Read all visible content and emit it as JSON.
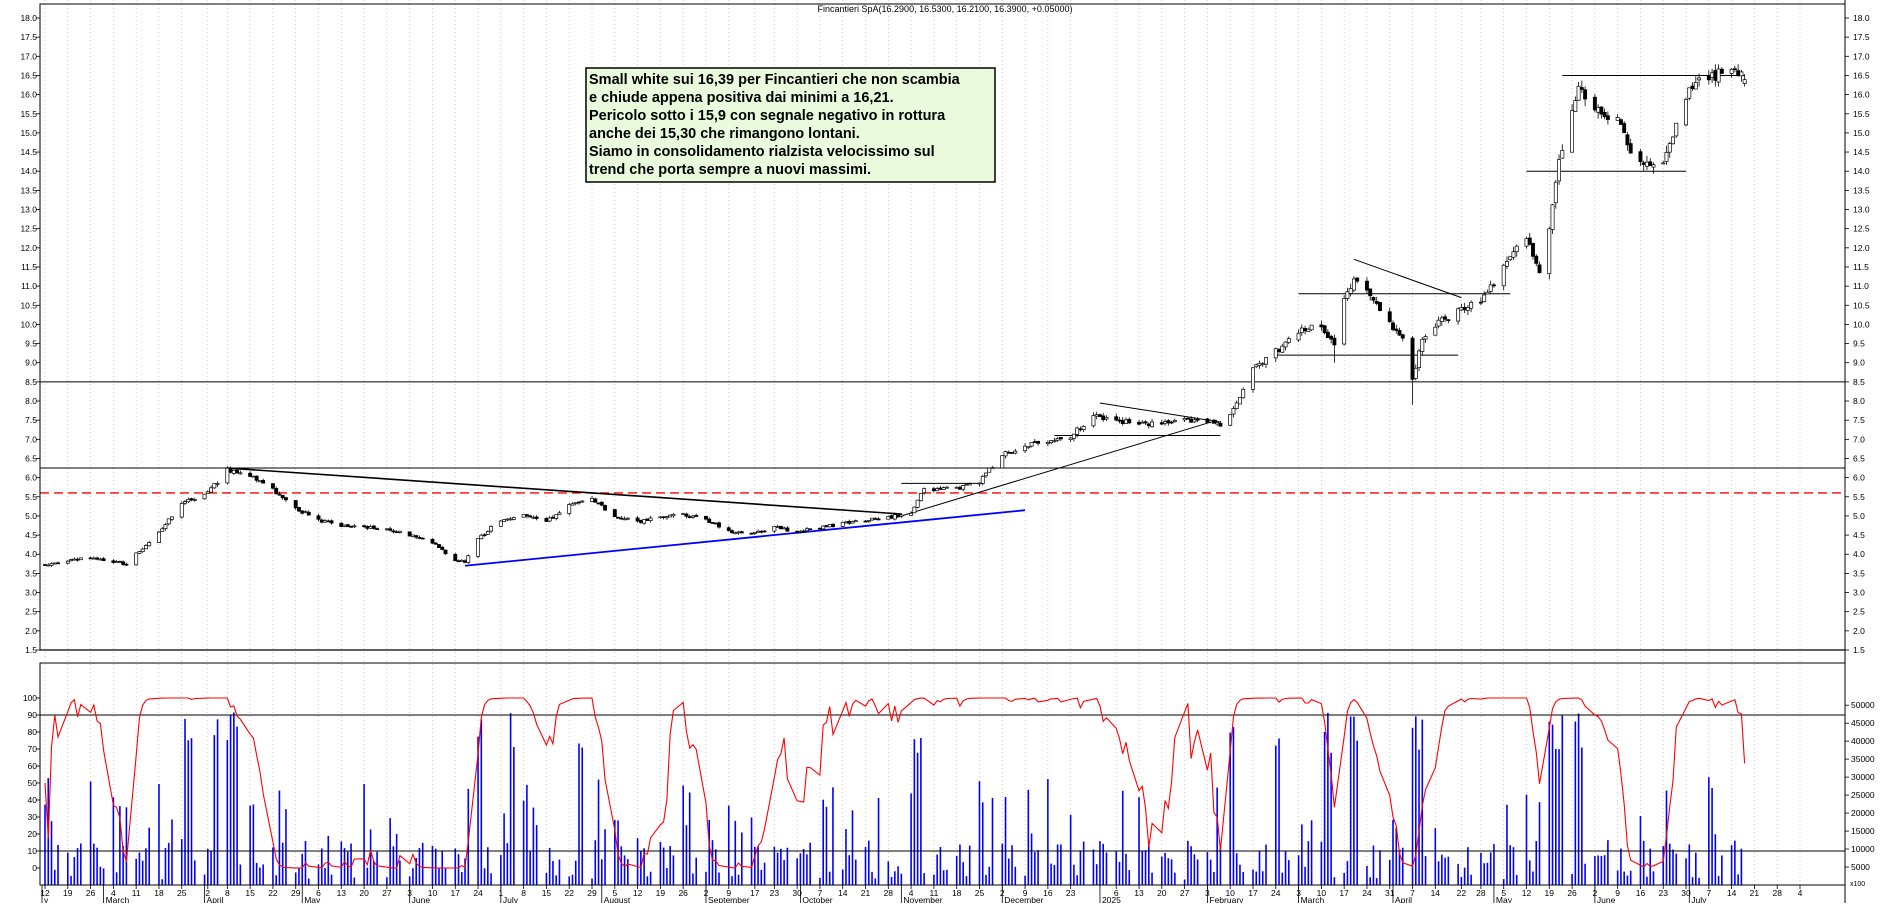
{
  "title": "Fincantieri SpA(16.2900, 16.5300, 16.2100, 16.3900, +0.05000)",
  "annotation": {
    "lines": [
      "Small white sui 16,39 per Fincantieri che non scambia",
      "e chiude appena positiva dai minimi a 16,21.",
      "Pericolo sotto i 15,9 con segnale negativo in rottura",
      "anche dei 15,30 che rimangono lontani.",
      "Siamo in consolidamento rialzista velocissimo sul",
      "trend che porta sempre a nuovi massimi."
    ],
    "bg_color": "#e9fbdc"
  },
  "colors": {
    "up": "#ffffff",
    "down": "#000000",
    "oscillator": "#ff0000",
    "volume": "#0000ff",
    "support_trendline": "#0000ff",
    "dashed_level": "#ff0000",
    "grid": "#b0b0b0"
  },
  "chart_data": [
    {
      "type": "candlestick",
      "name": "price",
      "grid": true,
      "ylim": [
        1.5,
        18.0
      ],
      "yticks": [
        "1.5",
        "2.0",
        "2.5",
        "3.0",
        "3.5",
        "4.0",
        "4.5",
        "5.0",
        "5.5",
        "6.0",
        "6.5",
        "7.0",
        "7.5",
        "8.0",
        "8.5",
        "9.0",
        "9.5",
        "10.0",
        "10.5",
        "11.0",
        "11.5",
        "12.0",
        "12.5",
        "13.0",
        "13.5",
        "14.0",
        "14.5",
        "15.0",
        "15.5",
        "16.0",
        "16.5",
        "17.0",
        "17.5",
        "18.0"
      ],
      "anchors": [
        [
          "2024-02-12",
          3.7
        ],
        [
          "2024-02-19",
          3.85
        ],
        [
          "2024-02-26",
          3.9
        ],
        [
          "2024-03-04",
          3.8
        ],
        [
          "2024-03-08",
          3.75
        ],
        [
          "2024-03-11",
          4.0
        ],
        [
          "2024-03-18",
          4.6
        ],
        [
          "2024-03-25",
          5.3
        ],
        [
          "2024-04-03",
          5.7
        ],
        [
          "2024-04-08",
          6.2
        ],
        [
          "2024-04-15",
          6.05
        ],
        [
          "2024-04-22",
          5.7
        ],
        [
          "2024-04-29",
          5.2
        ],
        [
          "2024-05-06",
          4.9
        ],
        [
          "2024-05-13",
          4.75
        ],
        [
          "2024-05-20",
          4.7
        ],
        [
          "2024-05-27",
          4.65
        ],
        [
          "2024-06-03",
          4.5
        ],
        [
          "2024-06-10",
          4.3
        ],
        [
          "2024-06-17",
          3.85
        ],
        [
          "2024-06-20",
          3.8
        ],
        [
          "2024-06-24",
          4.4
        ],
        [
          "2024-07-01",
          4.9
        ],
        [
          "2024-07-08",
          5.0
        ],
        [
          "2024-07-15",
          4.85
        ],
        [
          "2024-07-22",
          5.3
        ],
        [
          "2024-07-29",
          5.45
        ],
        [
          "2024-08-05",
          5.0
        ],
        [
          "2024-08-12",
          4.85
        ],
        [
          "2024-08-19",
          4.95
        ],
        [
          "2024-08-26",
          5.05
        ],
        [
          "2024-09-02",
          4.9
        ],
        [
          "2024-09-09",
          4.6
        ],
        [
          "2024-09-16",
          4.55
        ],
        [
          "2024-09-23",
          4.7
        ],
        [
          "2024-09-30",
          4.6
        ],
        [
          "2024-10-07",
          4.7
        ],
        [
          "2024-10-14",
          4.8
        ],
        [
          "2024-10-21",
          4.9
        ],
        [
          "2024-10-28",
          4.95
        ],
        [
          "2024-11-04",
          5.1
        ],
        [
          "2024-11-08",
          5.7
        ],
        [
          "2024-11-18",
          5.7
        ],
        [
          "2024-11-25",
          5.9
        ],
        [
          "2024-12-02",
          6.6
        ],
        [
          "2024-12-09",
          6.85
        ],
        [
          "2024-12-16",
          6.9
        ],
        [
          "2024-12-23",
          7.1
        ],
        [
          "2024-12-30",
          7.6
        ],
        [
          "2025-01-06",
          7.5
        ],
        [
          "2025-01-13",
          7.4
        ],
        [
          "2025-01-20",
          7.4
        ],
        [
          "2025-01-27",
          7.5
        ],
        [
          "2025-02-03",
          7.5
        ],
        [
          "2025-02-07",
          7.35
        ],
        [
          "2025-02-10",
          7.6
        ],
        [
          "2025-02-14",
          8.3
        ],
        [
          "2025-02-17",
          8.8
        ],
        [
          "2025-02-24",
          9.3
        ],
        [
          "2025-03-03",
          9.8
        ],
        [
          "2025-03-10",
          10.0
        ],
        [
          "2025-03-14",
          9.4
        ],
        [
          "2025-03-17",
          10.6
        ],
        [
          "2025-03-20",
          11.2
        ],
        [
          "2025-03-24",
          10.8
        ],
        [
          "2025-03-31",
          10.0
        ],
        [
          "2025-04-04",
          9.6
        ],
        [
          "2025-04-07",
          8.6
        ],
        [
          "2025-04-10",
          9.6
        ],
        [
          "2025-04-14",
          10.0
        ],
        [
          "2025-04-22",
          10.4
        ],
        [
          "2025-04-28",
          10.6
        ],
        [
          "2025-05-05",
          11.5
        ],
        [
          "2025-05-12",
          12.3
        ],
        [
          "2025-05-16",
          11.4
        ],
        [
          "2025-05-19",
          12.6
        ],
        [
          "2025-05-22",
          14.2
        ],
        [
          "2025-05-26",
          15.6
        ],
        [
          "2025-05-28",
          16.3
        ],
        [
          "2025-06-02",
          15.6
        ],
        [
          "2025-06-09",
          15.4
        ],
        [
          "2025-06-13",
          14.6
        ],
        [
          "2025-06-16",
          14.3
        ],
        [
          "2025-06-23",
          14.1
        ],
        [
          "2025-06-26",
          15.0
        ],
        [
          "2025-06-30",
          16.0
        ],
        [
          "2025-07-04",
          16.4
        ],
        [
          "2025-07-09",
          16.5
        ],
        [
          "2025-07-14",
          16.8
        ],
        [
          "2025-07-18",
          16.39
        ]
      ]
    },
    {
      "type": "line",
      "name": "oscillator",
      "ylim": [
        -10,
        100
      ],
      "yticks": [
        "0",
        "10",
        "20",
        "30",
        "40",
        "50",
        "60",
        "70",
        "80",
        "90",
        "100"
      ],
      "reference_levels": [
        10,
        90
      ]
    },
    {
      "type": "bar",
      "name": "volume",
      "ylim": [
        0,
        52000
      ],
      "yticks": [
        "5000",
        "10000",
        "15000",
        "20000",
        "25000",
        "30000",
        "35000",
        "40000",
        "45000",
        "50000"
      ]
    }
  ],
  "x_axis": {
    "days": [
      [
        "2024-02-12",
        "12"
      ],
      [
        "2024-02-19",
        "19"
      ],
      [
        "2024-02-26",
        "26"
      ],
      [
        "2024-03-04",
        "4"
      ],
      [
        "2024-03-11",
        "11"
      ],
      [
        "2024-03-18",
        "18"
      ],
      [
        "2024-03-25",
        "25"
      ],
      [
        "2024-04-02",
        "2"
      ],
      [
        "2024-04-08",
        "8"
      ],
      [
        "2024-04-15",
        "15"
      ],
      [
        "2024-04-22",
        "22"
      ],
      [
        "2024-04-29",
        "29"
      ],
      [
        "2024-05-06",
        "6"
      ],
      [
        "2024-05-13",
        "13"
      ],
      [
        "2024-05-20",
        "20"
      ],
      [
        "2024-05-27",
        "27"
      ],
      [
        "2024-06-03",
        "3"
      ],
      [
        "2024-06-10",
        "10"
      ],
      [
        "2024-06-17",
        "17"
      ],
      [
        "2024-06-24",
        "24"
      ],
      [
        "2024-07-01",
        "1"
      ],
      [
        "2024-07-08",
        "8"
      ],
      [
        "2024-07-15",
        "15"
      ],
      [
        "2024-07-22",
        "22"
      ],
      [
        "2024-07-29",
        "29"
      ],
      [
        "2024-08-05",
        "5"
      ],
      [
        "2024-08-12",
        "12"
      ],
      [
        "2024-08-19",
        "19"
      ],
      [
        "2024-08-26",
        "26"
      ],
      [
        "2024-09-02",
        "2"
      ],
      [
        "2024-09-09",
        "9"
      ],
      [
        "2024-09-17",
        "17"
      ],
      [
        "2024-09-23",
        "23"
      ],
      [
        "2024-09-30",
        "30"
      ],
      [
        "2024-10-07",
        "7"
      ],
      [
        "2024-10-14",
        "14"
      ],
      [
        "2024-10-21",
        "21"
      ],
      [
        "2024-10-28",
        "28"
      ],
      [
        "2024-11-04",
        "4"
      ],
      [
        "2024-11-11",
        "11"
      ],
      [
        "2024-11-18",
        "18"
      ],
      [
        "2024-11-25",
        "25"
      ],
      [
        "2024-12-02",
        "2"
      ],
      [
        "2024-12-09",
        "9"
      ],
      [
        "2024-12-16",
        "16"
      ],
      [
        "2024-12-23",
        "23"
      ],
      [
        "2025-01-06",
        "6"
      ],
      [
        "2025-01-13",
        "13"
      ],
      [
        "2025-01-20",
        "20"
      ],
      [
        "2025-01-27",
        "27"
      ],
      [
        "2025-02-03",
        "3"
      ],
      [
        "2025-02-10",
        "10"
      ],
      [
        "2025-02-17",
        "17"
      ],
      [
        "2025-02-24",
        "24"
      ],
      [
        "2025-03-03",
        "3"
      ],
      [
        "2025-03-10",
        "10"
      ],
      [
        "2025-03-17",
        "17"
      ],
      [
        "2025-03-24",
        "24"
      ],
      [
        "2025-03-31",
        "31"
      ],
      [
        "2025-04-07",
        "7"
      ],
      [
        "2025-04-14",
        "14"
      ],
      [
        "2025-04-22",
        "22"
      ],
      [
        "2025-04-28",
        "28"
      ],
      [
        "2025-05-05",
        "5"
      ],
      [
        "2025-05-12",
        "12"
      ],
      [
        "2025-05-19",
        "19"
      ],
      [
        "2025-05-26",
        "26"
      ],
      [
        "2025-06-02",
        "2"
      ],
      [
        "2025-06-09",
        "9"
      ],
      [
        "2025-06-16",
        "16"
      ],
      [
        "2025-06-23",
        "23"
      ],
      [
        "2025-06-30",
        "30"
      ],
      [
        "2025-07-07",
        "7"
      ],
      [
        "2025-07-14",
        "14"
      ],
      [
        "2025-07-21",
        "21"
      ],
      [
        "2025-07-28",
        "28"
      ],
      [
        "2025-08-04",
        "4"
      ]
    ],
    "months": [
      [
        "2024-02-05",
        "y"
      ],
      [
        "2024-03-01",
        "March"
      ],
      [
        "2024-04-01",
        "April"
      ],
      [
        "2024-05-01",
        "May"
      ],
      [
        "2024-06-03",
        "June"
      ],
      [
        "2024-07-01",
        "July"
      ],
      [
        "2024-08-01",
        "August"
      ],
      [
        "2024-09-02",
        "September"
      ],
      [
        "2024-10-01",
        "October"
      ],
      [
        "2024-11-01",
        "November"
      ],
      [
        "2024-12-02",
        "December"
      ],
      [
        "2025-01-01",
        "2025"
      ],
      [
        "2025-02-03",
        "February"
      ],
      [
        "2025-03-03",
        "March"
      ],
      [
        "2025-04-01",
        "April"
      ],
      [
        "2025-05-02",
        "May"
      ],
      [
        "2025-06-02",
        "June"
      ],
      [
        "2025-07-01",
        "July"
      ]
    ],
    "scale_label": "x100"
  },
  "drawings": {
    "horizontal_levels": [
      8.5,
      6.25
    ],
    "dashed_levels": [
      5.6
    ],
    "segments": [
      {
        "color": "#000000",
        "width": 1.6,
        "points": [
          [
            "2024-04-08",
            6.25
          ],
          [
            "2024-11-01",
            5.05
          ]
        ]
      },
      {
        "color": "#0000ff",
        "width": 1.8,
        "points": [
          [
            "2024-06-20",
            3.7
          ],
          [
            "2024-12-09",
            5.15
          ]
        ]
      },
      {
        "color": "#000000",
        "width": 1,
        "points": [
          [
            "2024-10-30",
            4.95
          ],
          [
            "2025-02-06",
            7.5
          ]
        ]
      },
      {
        "color": "#000000",
        "width": 1,
        "points": [
          [
            "2024-11-01",
            5.85
          ],
          [
            "2024-11-26",
            5.85
          ]
        ]
      },
      {
        "color": "#000000",
        "width": 1,
        "points": [
          [
            "2024-12-18",
            7.1
          ],
          [
            "2025-02-07",
            7.1
          ]
        ]
      },
      {
        "color": "#000000",
        "width": 1,
        "points": [
          [
            "2025-01-01",
            7.95
          ],
          [
            "2025-02-07",
            7.45
          ]
        ]
      },
      {
        "color": "#000000",
        "width": 1,
        "points": [
          [
            "2025-02-24",
            9.2
          ],
          [
            "2025-04-21",
            9.2
          ]
        ]
      },
      {
        "color": "#000000",
        "width": 1,
        "points": [
          [
            "2025-03-03",
            10.8
          ],
          [
            "2025-05-07",
            10.8
          ]
        ]
      },
      {
        "color": "#000000",
        "width": 1,
        "points": [
          [
            "2025-03-20",
            11.7
          ],
          [
            "2025-04-22",
            10.7
          ]
        ]
      },
      {
        "color": "#000000",
        "width": 1,
        "points": [
          [
            "2025-05-12",
            14.0
          ],
          [
            "2025-06-30",
            14.0
          ]
        ]
      },
      {
        "color": "#000000",
        "width": 1,
        "points": [
          [
            "2025-05-23",
            16.5
          ],
          [
            "2025-07-18",
            16.5
          ]
        ]
      }
    ]
  }
}
